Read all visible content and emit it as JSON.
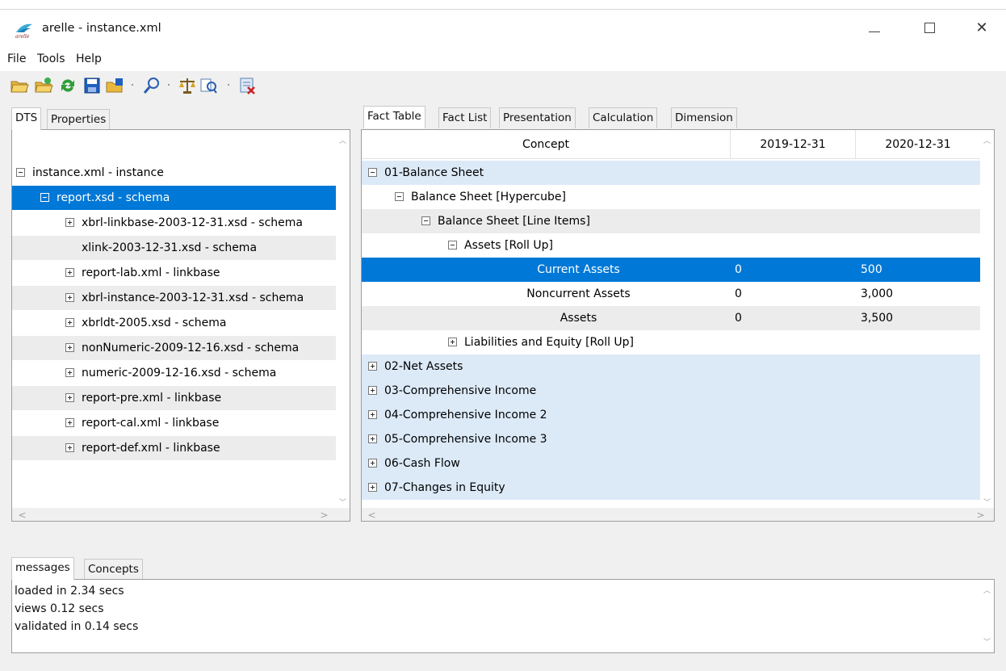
{
  "window": {
    "title": "arelle - instance.xml",
    "min_symbol": "—",
    "close_symbol": "✕"
  },
  "menu": [
    "File",
    "Tools",
    "Help"
  ],
  "toolbar_icons": [
    "open-folder-icon",
    "open-web-icon",
    "reload-icon",
    "save-icon",
    "save-as-icon",
    "find-icon",
    "validate-icon",
    "compare-icon",
    "close-icon"
  ],
  "left_tabs": [
    "DTS",
    "Properties"
  ],
  "dts_tree": [
    {
      "label": "instance.xml - instance",
      "indent": 0,
      "expander": "minus",
      "style": "white"
    },
    {
      "label": "report.xsd - schema",
      "indent": 1,
      "expander": "minus",
      "style": "selected"
    },
    {
      "label": "xbrl-linkbase-2003-12-31.xsd - schema",
      "indent": 2,
      "expander": "plus",
      "style": "white"
    },
    {
      "label": "xlink-2003-12-31.xsd - schema",
      "indent": 2,
      "expander": "none",
      "style": "stripe"
    },
    {
      "label": "report-lab.xml - linkbase",
      "indent": 2,
      "expander": "plus",
      "style": "white"
    },
    {
      "label": "xbrl-instance-2003-12-31.xsd - schema",
      "indent": 2,
      "expander": "plus",
      "style": "stripe"
    },
    {
      "label": "xbrldt-2005.xsd - schema",
      "indent": 2,
      "expander": "plus",
      "style": "white"
    },
    {
      "label": "nonNumeric-2009-12-16.xsd - schema",
      "indent": 2,
      "expander": "plus",
      "style": "stripe"
    },
    {
      "label": "numeric-2009-12-16.xsd - schema",
      "indent": 2,
      "expander": "plus",
      "style": "white"
    },
    {
      "label": "report-pre.xml - linkbase",
      "indent": 2,
      "expander": "plus",
      "style": "stripe"
    },
    {
      "label": "report-cal.xml - linkbase",
      "indent": 2,
      "expander": "plus",
      "style": "white"
    },
    {
      "label": "report-def.xml - linkbase",
      "indent": 2,
      "expander": "plus",
      "style": "stripe"
    }
  ],
  "right_tabs": [
    "Fact Table",
    "Fact List",
    "Presentation",
    "Calculation",
    "Dimension"
  ],
  "fact_table": {
    "columns": [
      "Concept",
      "2019-12-31",
      "2020-12-31"
    ],
    "rows": [
      {
        "label": "01-Balance Sheet",
        "level": 0,
        "expander": "minus",
        "style": "blue",
        "v1": "",
        "v2": ""
      },
      {
        "label": "Balance Sheet [Hypercube]",
        "level": 1,
        "expander": "minus",
        "style": "white",
        "v1": "",
        "v2": ""
      },
      {
        "label": "Balance Sheet [Line Items]",
        "level": 2,
        "expander": "minus",
        "style": "gray",
        "v1": "",
        "v2": ""
      },
      {
        "label": "Assets [Roll Up]",
        "level": 3,
        "expander": "minus",
        "style": "white",
        "v1": "",
        "v2": ""
      },
      {
        "label": "Current Assets",
        "level": 4,
        "expander": "none",
        "style": "selected",
        "v1": "0",
        "v2": "500"
      },
      {
        "label": "Noncurrent Assets",
        "level": 4,
        "expander": "none",
        "style": "white",
        "v1": "0",
        "v2": "3,000"
      },
      {
        "label": "Assets",
        "level": 4,
        "expander": "none",
        "style": "gray",
        "v1": "0",
        "v2": "3,500"
      },
      {
        "label": "Liabilities and Equity [Roll Up]",
        "level": 3,
        "expander": "plus",
        "style": "white",
        "v1": "",
        "v2": ""
      },
      {
        "label": "02-Net Assets",
        "level": 0,
        "expander": "plus",
        "style": "blue",
        "v1": "",
        "v2": ""
      },
      {
        "label": "03-Comprehensive Income",
        "level": 0,
        "expander": "plus",
        "style": "blue",
        "v1": "",
        "v2": ""
      },
      {
        "label": "04-Comprehensive Income 2",
        "level": 0,
        "expander": "plus",
        "style": "blue",
        "v1": "",
        "v2": ""
      },
      {
        "label": "05-Comprehensive Income 3",
        "level": 0,
        "expander": "plus",
        "style": "blue",
        "v1": "",
        "v2": ""
      },
      {
        "label": "06-Cash Flow",
        "level": 0,
        "expander": "plus",
        "style": "blue",
        "v1": "",
        "v2": ""
      },
      {
        "label": "07-Changes in Equity",
        "level": 0,
        "expander": "plus",
        "style": "blue",
        "v1": "",
        "v2": ""
      }
    ]
  },
  "bottom_tabs": [
    "messages",
    "Concepts"
  ],
  "messages": [
    "loaded in 2.34 secs",
    "views 0.12 secs",
    "validated in 0.14 secs"
  ],
  "colors": {
    "selection": "#0078d7",
    "row_blue": "#dceaf8",
    "row_stripe": "#ececec"
  }
}
